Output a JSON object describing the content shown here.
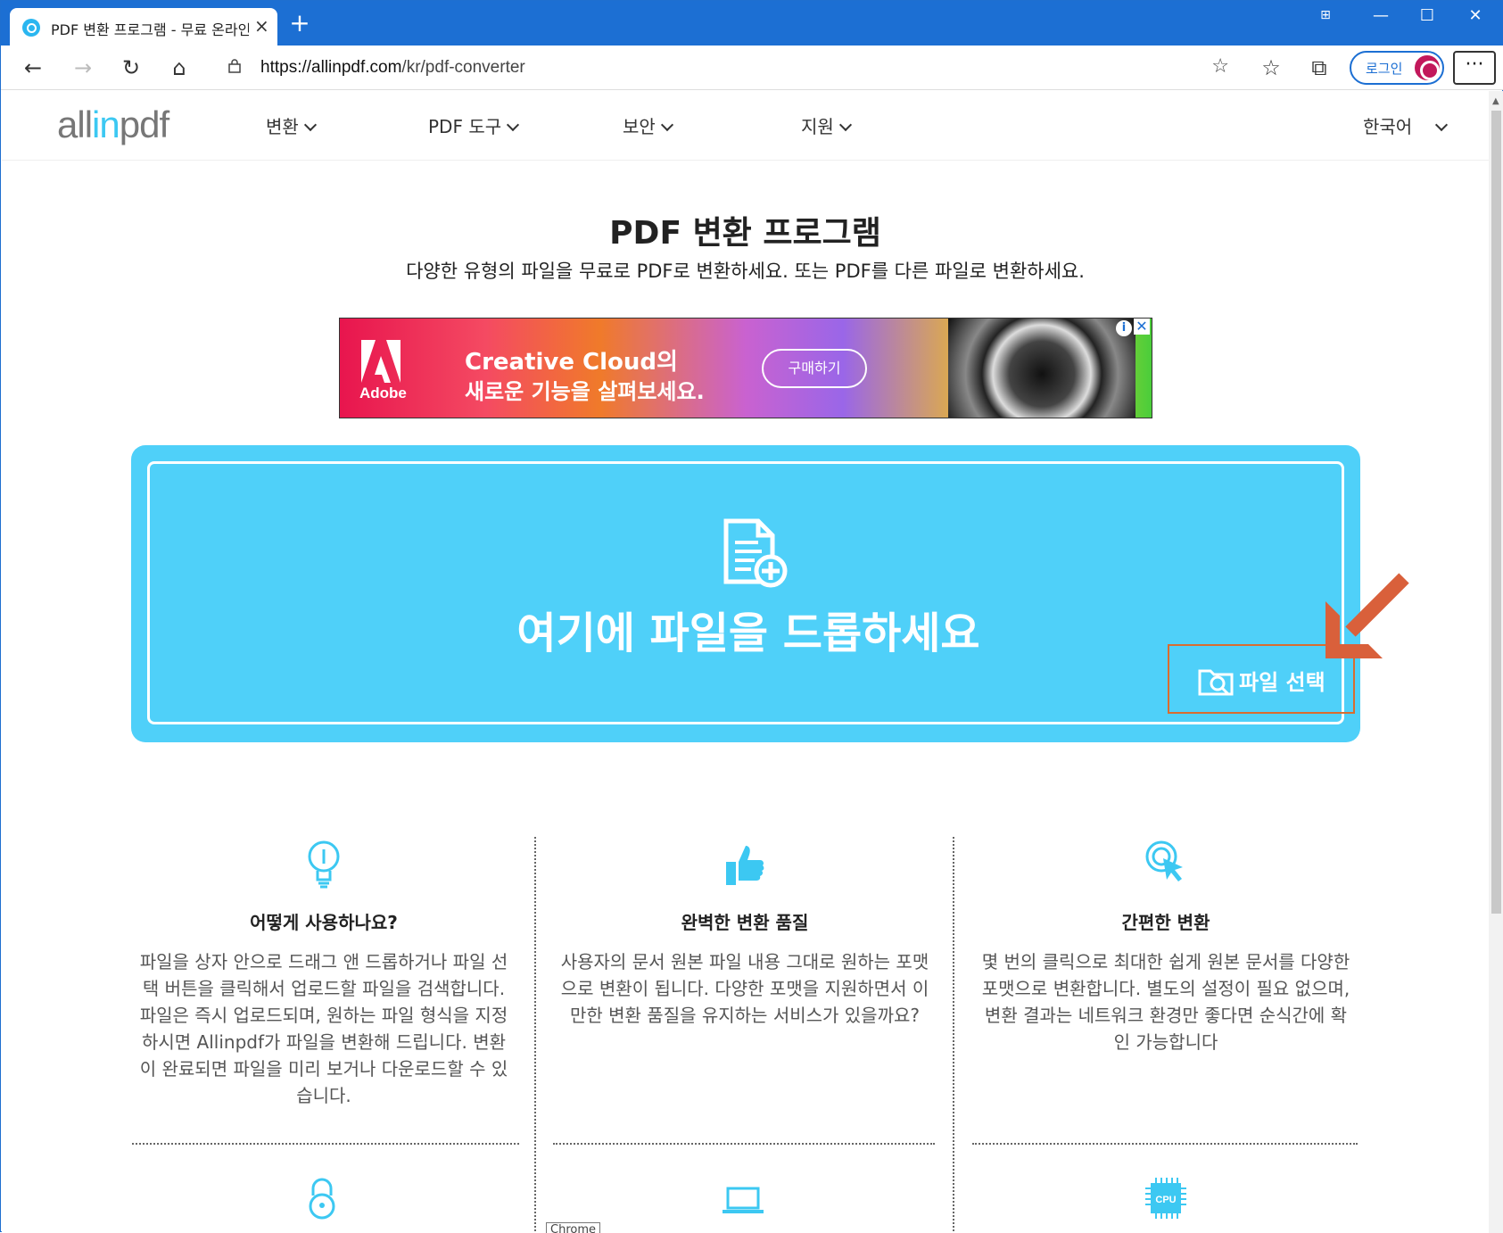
{
  "browser": {
    "tab_title": "PDF 변환 프로그램 - 무료 온라인",
    "url_prefix": "https://allinpdf.com",
    "url_path": "/kr/pdf-converter",
    "login_label": "로그인",
    "menu_label": "···",
    "tooltip": "Chrome"
  },
  "site": {
    "logo_a": "all",
    "logo_b": "in",
    "logo_c": "pdf",
    "nav": [
      "변환",
      "PDF 도구",
      "보안",
      "지원"
    ],
    "language": "한국어"
  },
  "hero": {
    "title": "PDF 변환 프로그램",
    "subtitle": "다양한 유형의 파일을 무료로 PDF로 변환하세요. 또는 PDF를 다른 파일로 변환하세요."
  },
  "ad": {
    "brand": "Adobe",
    "line1": "Creative Cloud의",
    "line2": "새로운 기능을 살펴보세요.",
    "button": "구매하기"
  },
  "dropzone": {
    "text": "여기에 파일을 드롭하세요",
    "button": "파일 선택"
  },
  "features": [
    {
      "title": "어떻게 사용하나요?",
      "desc": "파일을 상자 안으로 드래그 앤 드롭하거나 파일 선택 버튼을 클릭해서 업로드할 파일을 검색합니다. 파일은 즉시 업로드되며, 원하는 파일 형식을 지정하시면 Allinpdf가 파일을 변환해 드립니다. 변환이 완료되면 파일을 미리 보거나 다운로드할 수 있습니다."
    },
    {
      "title": "완벽한 변환 품질",
      "desc": "사용자의 문서 원본 파일 내용 그대로 원하는 포맷으로 변환이 됩니다. 다양한 포맷을 지원하면서 이만한 변환 품질을 유지하는 서비스가 있을까요?"
    },
    {
      "title": "간편한 변환",
      "desc": "몇 번의 클릭으로 최대한 쉽게 원본 문서를 다양한 포맷으로 변환합니다. 별도의 설정이 필요 없으며, 변환 결과는 네트워크 환경만 좋다면 순식간에 확인 가능합니다"
    }
  ],
  "icons": {
    "feature1": "lightbulb-icon",
    "feature2": "thumbs-up-icon",
    "feature3": "click-pointer-icon",
    "row2_1": "padlock-icon",
    "row2_2": "laptop-icon",
    "row2_3": "cpu-icon",
    "cpu_label": "CPU"
  },
  "colors": {
    "accent": "#4fd0f9",
    "browser_blue": "#1c6fd3",
    "highlight": "#d96c2f"
  }
}
